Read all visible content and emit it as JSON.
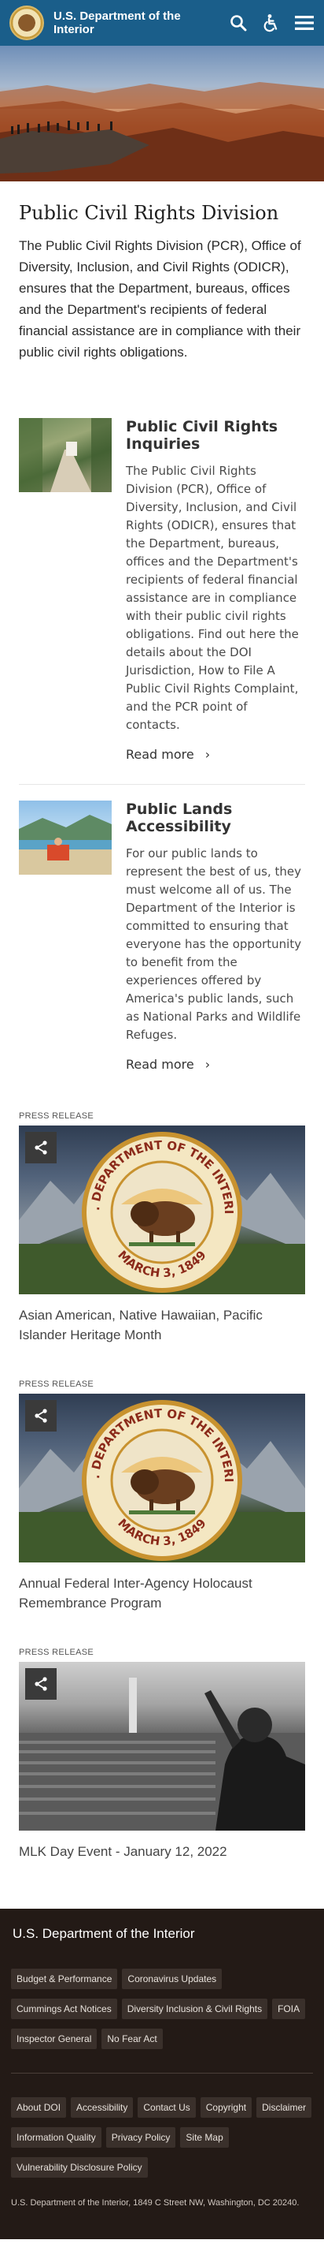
{
  "header": {
    "title": "U.S. Department of the Interior",
    "icons": [
      "search-icon",
      "accessibility-icon",
      "menu-icon"
    ],
    "bar_color": "#1a5e8a"
  },
  "page": {
    "title": "Public Civil Rights Division",
    "intro": "The Public Civil Rights Division (PCR), Office of Diversity, Inclusion, and Civil Rights (ODICR), ensures that the Department, bureaus, offices and the Department's recipients of federal financial assistance are in compliance with their public civil rights obligations."
  },
  "features": [
    {
      "title": "Public Civil Rights Inquiries",
      "text": "The Public Civil Rights Division (PCR), Office of Diversity, Inclusion, and Civil Rights (ODICR), ensures that the Department, bureaus, offices and the Department's recipients of federal financial assistance are in compliance with their public civil rights obligations. Find out here the details about the DOI Jurisdiction, How to File A Public Civil Rights Complaint, and the PCR point of contacts.",
      "link": "Read more"
    },
    {
      "title": "Public Lands Accessibility",
      "text": "For our public lands to represent the best of us, they must welcome all of us. The Department of the Interior is committed to ensuring that everyone has the opportunity to benefit from the experiences offered by America's public lands, such as National Parks and Wildlife Refuges.",
      "link": "Read more"
    }
  ],
  "press": [
    {
      "label": "PRESS RELEASE",
      "caption": "Asian American, Native Hawaiian, Pacific Islander Heritage Month"
    },
    {
      "label": "PRESS RELEASE",
      "caption": "Annual Federal Inter-Agency Holocaust Remembrance Program"
    },
    {
      "label": "PRESS RELEASE",
      "caption": "MLK Day Event - January 12, 2022"
    }
  ],
  "seal": {
    "top_text": "U.S. DEPARTMENT OF THE INTERIOR",
    "bottom_text": "MARCH 3, 1849"
  },
  "footer": {
    "title": "U.S. Department of the Interior",
    "primary_links": [
      "Budget & Performance",
      "Coronavirus Updates",
      "Cummings Act Notices",
      "Diversity Inclusion & Civil Rights",
      "FOIA",
      "Inspector General",
      "No Fear Act"
    ],
    "secondary_links": [
      "About DOI",
      "Accessibility",
      "Contact Us",
      "Copyright",
      "Disclaimer",
      "Information Quality",
      "Privacy Policy",
      "Site Map",
      "Vulnerability Disclosure Policy"
    ],
    "address": "U.S. Department of the Interior, 1849 C Street NW, Washington, DC 20240."
  }
}
